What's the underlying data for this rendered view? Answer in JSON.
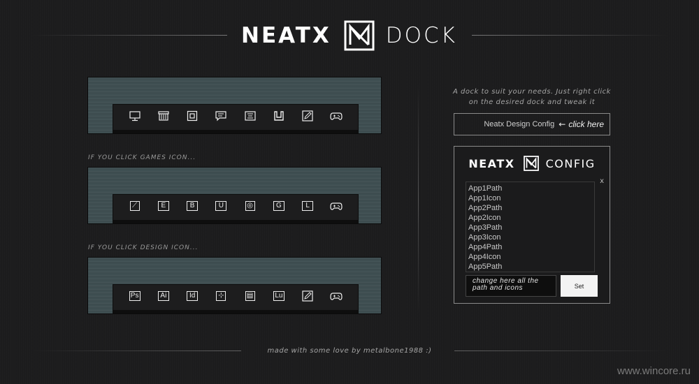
{
  "header": {
    "brand": "NEATX",
    "product": "DOCK"
  },
  "docks": [
    {
      "label": "",
      "icons": [
        "monitor-icon",
        "archive-icon",
        "square-icon",
        "chat-icon",
        "document-icon",
        "magnet-icon",
        "pen-icon",
        "gamepad-icon"
      ]
    },
    {
      "label": "IF YOU CLICK GAMES ICON...",
      "icons": [
        {
          "name": "steam-icon",
          "glyph": "⟋"
        },
        {
          "name": "e-icon",
          "glyph": "E"
        },
        {
          "name": "b-icon",
          "glyph": "B"
        },
        {
          "name": "u-icon",
          "glyph": "U"
        },
        {
          "name": "origin-icon",
          "glyph": "◎"
        },
        {
          "name": "g-icon",
          "glyph": "G"
        },
        {
          "name": "l-icon",
          "glyph": "L"
        },
        {
          "name": "gamepad-icon",
          "glyph": ""
        }
      ]
    },
    {
      "label": "IF YOU CLICK DESIGN ICON...",
      "icons": [
        {
          "name": "photoshop-icon",
          "glyph": "Ps"
        },
        {
          "name": "illustrator-icon",
          "glyph": "Ai"
        },
        {
          "name": "indesign-icon",
          "glyph": "Id"
        },
        {
          "name": "crosshair-icon",
          "glyph": "⊹"
        },
        {
          "name": "layout-icon",
          "glyph": "▤"
        },
        {
          "name": "lightroom-icon",
          "glyph": "Lu"
        },
        {
          "name": "pen-icon",
          "glyph": ""
        },
        {
          "name": "gamepad-icon",
          "glyph": ""
        }
      ]
    }
  ],
  "description": "A dock to suit your needs. Just right click on the desired dock and tweak it",
  "config_button": {
    "label": "Neatx Design Config",
    "arrow": "←",
    "hint": "click here"
  },
  "config_panel": {
    "brand": "NEATX",
    "title": "CONFIG",
    "close": "x",
    "items": [
      "App1Path",
      "App1Icon",
      "App2Path",
      "App2Icon",
      "App3Path",
      "App3Icon",
      "App4Path",
      "App4Icon",
      "App5Path"
    ],
    "input_value": "change here all the path and icons",
    "set_label": "Set"
  },
  "footer": "made with some love by metalbone1988 :)",
  "watermark": "www.wincore.ru"
}
